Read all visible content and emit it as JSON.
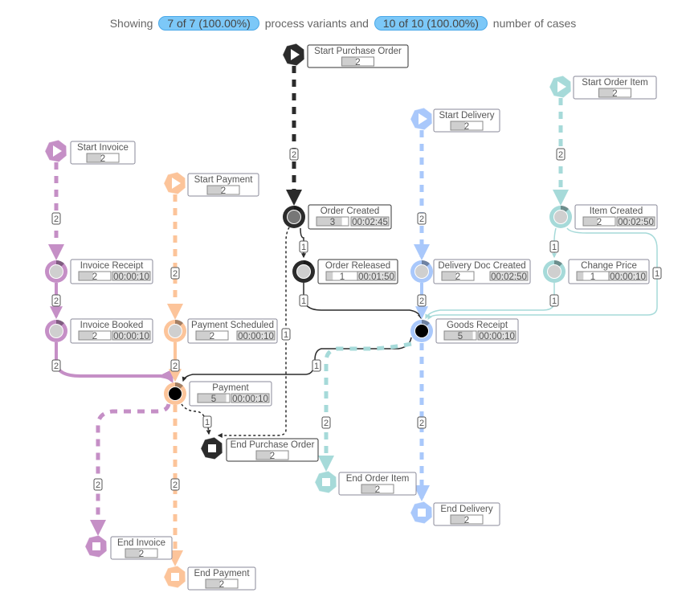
{
  "header": {
    "prefix": "Showing",
    "variants_pill": "7 of 7 (100.00%)",
    "middle": "process variants and",
    "cases_pill": "10 of 10 (100.00%)",
    "suffix": "number of cases"
  },
  "object_types": {
    "purchase_order": "#2b2b2b",
    "invoice": "#c58fc6",
    "payment": "#fcc49a",
    "delivery": "#a9c8fb",
    "order_item": "#a6dad9"
  },
  "nodes": [
    {
      "id": "spo",
      "kind": "start",
      "type": "purchase_order",
      "label": "Start Purchase Order",
      "count": "2"
    },
    {
      "id": "oc",
      "kind": "activity",
      "type": "purchase_order",
      "label": "Order Created",
      "count": "3",
      "duration": "00:02:45"
    },
    {
      "id": "or",
      "kind": "activity",
      "type": "purchase_order",
      "label": "Order Released",
      "count": "1",
      "duration": "00:01:50"
    },
    {
      "id": "sd",
      "kind": "start",
      "type": "delivery",
      "label": "Start Delivery",
      "count": "2"
    },
    {
      "id": "ddc",
      "kind": "activity",
      "type": "delivery",
      "label": "Delivery Doc Created",
      "count": "2",
      "duration": "00:02:50"
    },
    {
      "id": "gr",
      "kind": "activity",
      "type": "delivery",
      "label": "Goods Receipt",
      "count": "5",
      "duration": "00:00:10"
    },
    {
      "id": "soi",
      "kind": "start",
      "type": "order_item",
      "label": "Start Order Item",
      "count": "2"
    },
    {
      "id": "ic",
      "kind": "activity",
      "type": "order_item",
      "label": "Item Created",
      "count": "2",
      "duration": "00:02:50"
    },
    {
      "id": "cp",
      "kind": "activity",
      "type": "order_item",
      "label": "Change Price",
      "count": "1",
      "duration": "00:00:10"
    },
    {
      "id": "si",
      "kind": "start",
      "type": "invoice",
      "label": "Start Invoice",
      "count": "2"
    },
    {
      "id": "ir",
      "kind": "activity",
      "type": "invoice",
      "label": "Invoice Receipt",
      "count": "2",
      "duration": "00:00:10"
    },
    {
      "id": "ib",
      "kind": "activity",
      "type": "invoice",
      "label": "Invoice Booked",
      "count": "2",
      "duration": "00:00:10"
    },
    {
      "id": "sp",
      "kind": "start",
      "type": "payment",
      "label": "Start Payment",
      "count": "2"
    },
    {
      "id": "ps",
      "kind": "activity",
      "type": "payment",
      "label": "Payment Scheduled",
      "count": "2",
      "duration": "00:00:10"
    },
    {
      "id": "pay",
      "kind": "activity",
      "type": "payment",
      "label": "Payment",
      "count": "5",
      "duration": "00:00:10"
    },
    {
      "id": "epo",
      "kind": "end",
      "type": "purchase_order",
      "label": "End Purchase Order",
      "count": "2"
    },
    {
      "id": "eoi",
      "kind": "end",
      "type": "order_item",
      "label": "End Order Item",
      "count": "2"
    },
    {
      "id": "ed",
      "kind": "end",
      "type": "delivery",
      "label": "End Delivery",
      "count": "2"
    },
    {
      "id": "ei",
      "kind": "end",
      "type": "invoice",
      "label": "End Invoice",
      "count": "2"
    },
    {
      "id": "ep",
      "kind": "end",
      "type": "payment",
      "label": "End Payment",
      "count": "2"
    }
  ],
  "edges": [
    {
      "from": "spo",
      "to": "oc",
      "type": "purchase_order",
      "style": "dashed",
      "label": "2"
    },
    {
      "from": "oc",
      "to": "or",
      "type": "purchase_order",
      "style": "solid",
      "label": "1"
    },
    {
      "from": "or",
      "to": "gr",
      "type": "purchase_order",
      "style": "solid",
      "label": "1"
    },
    {
      "from": "oc",
      "to": "epo",
      "type": "purchase_order",
      "style": "dotted",
      "label": "1"
    },
    {
      "from": "gr",
      "to": "pay",
      "type": "purchase_order",
      "style": "solid",
      "label": "1"
    },
    {
      "from": "pay",
      "to": "epo",
      "type": "purchase_order",
      "style": "dotted",
      "label": "1"
    },
    {
      "from": "sd",
      "to": "ddc",
      "type": "delivery",
      "style": "dashed",
      "label": "2"
    },
    {
      "from": "ddc",
      "to": "gr",
      "type": "delivery",
      "style": "solid",
      "label": "2"
    },
    {
      "from": "gr",
      "to": "ed",
      "type": "delivery",
      "style": "dashed",
      "label": "2"
    },
    {
      "from": "soi",
      "to": "ic",
      "type": "order_item",
      "style": "dashed",
      "label": "2"
    },
    {
      "from": "ic",
      "to": "cp",
      "type": "order_item",
      "style": "solid",
      "label": "1"
    },
    {
      "from": "cp",
      "to": "gr",
      "type": "order_item",
      "style": "solid",
      "label": "1"
    },
    {
      "from": "ic",
      "to": "gr",
      "type": "order_item",
      "style": "solid",
      "label": "1"
    },
    {
      "from": "gr",
      "to": "eoi",
      "type": "order_item",
      "style": "dashed",
      "label": "2"
    },
    {
      "from": "si",
      "to": "ir",
      "type": "invoice",
      "style": "dashed",
      "label": "2"
    },
    {
      "from": "ir",
      "to": "ib",
      "type": "invoice",
      "style": "solid",
      "label": "2"
    },
    {
      "from": "ib",
      "to": "pay",
      "type": "invoice",
      "style": "solid",
      "label": "2"
    },
    {
      "from": "pay",
      "to": "ei",
      "type": "invoice",
      "style": "dashed",
      "label": "2"
    },
    {
      "from": "sp",
      "to": "ps",
      "type": "payment",
      "style": "dashed",
      "label": "2"
    },
    {
      "from": "ps",
      "to": "pay",
      "type": "payment",
      "style": "solid",
      "label": "2"
    },
    {
      "from": "pay",
      "to": "ep",
      "type": "payment",
      "style": "dashed",
      "label": "2"
    }
  ]
}
